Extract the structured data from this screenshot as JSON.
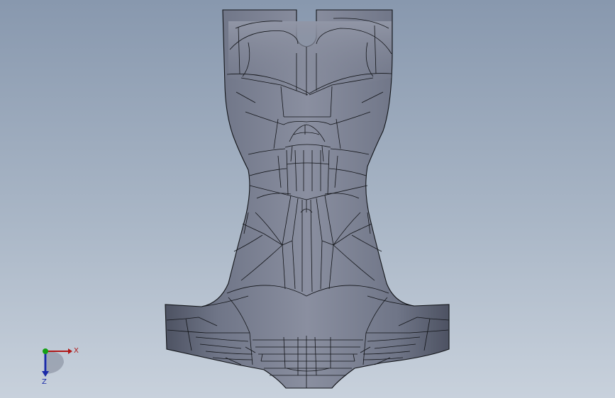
{
  "viewport": {
    "background_top": "#8898ae",
    "background_bottom": "#c8d1dc",
    "model_fill": "#7a7f90",
    "model_edge": "#121418"
  },
  "triad": {
    "x_label": "X",
    "z_label": "Z",
    "x_color": "#b01818",
    "y_color": "#14a014",
    "z_color": "#1a2aa8"
  }
}
